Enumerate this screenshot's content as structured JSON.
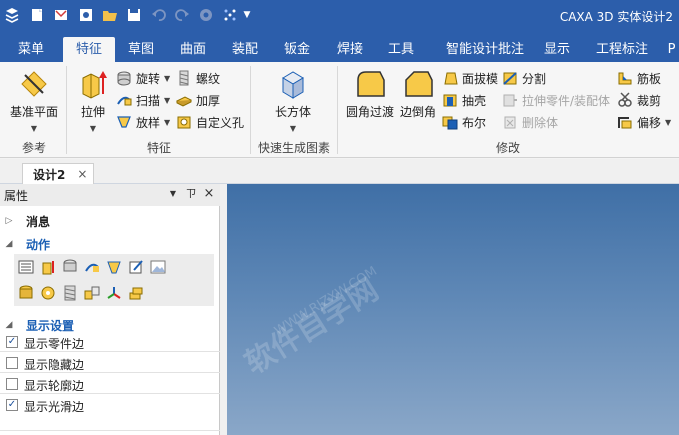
{
  "title": "CAXA 3D 实体设计2",
  "tabs": [
    "菜单",
    "特征",
    "草图",
    "曲面",
    "装配",
    "钣金",
    "焊接",
    "工具",
    "智能设计批注",
    "显示",
    "工程标注",
    "P"
  ],
  "active_tab": "特征",
  "ribbon": {
    "ref": {
      "label": "参考",
      "plane_btn": "基准平面"
    },
    "feature": {
      "label": "特征",
      "extrude": "拉伸",
      "revolve": "旋转",
      "sweep": "扫描",
      "loft": "放样",
      "thread": "螺纹",
      "thicken": "加厚",
      "custom_hole": "自定义孔"
    },
    "quick": {
      "label": "快速生成图素",
      "box": "长方体"
    },
    "modify": {
      "label": "修改",
      "fillet": "圆角过渡",
      "chamfer": "边倒角",
      "draft": "面拔模",
      "shell": "抽壳",
      "boolean": "布尔",
      "split": "分割",
      "stretch": "拉伸零件/装配体",
      "delete_body": "删除体",
      "rib": "筋板",
      "trim": "裁剪",
      "offset": "偏移"
    }
  },
  "doc_tab": {
    "name": "设计2",
    "close": "×"
  },
  "panel": {
    "title": "属性",
    "pin": "ㄗ",
    "close": "×",
    "sections": {
      "messages": "消息",
      "actions": "动作",
      "display": "显示设置"
    },
    "display_options": [
      {
        "label": "显示零件边",
        "checked": true
      },
      {
        "label": "显示隐藏边",
        "checked": false
      },
      {
        "label": "显示轮廓边",
        "checked": false
      },
      {
        "label": "显示光滑边",
        "checked": true
      }
    ]
  },
  "watermark": {
    "main": "软件自学网",
    "url": "WWW.RJZXW.COM"
  },
  "colors": {
    "titlebar": "#2c5eab",
    "active_tab_text": "#2c5eab",
    "section_blue": "#1b5fb4",
    "viewport_top": "#3f6fa6",
    "viewport_bottom": "#8aa7c8"
  }
}
